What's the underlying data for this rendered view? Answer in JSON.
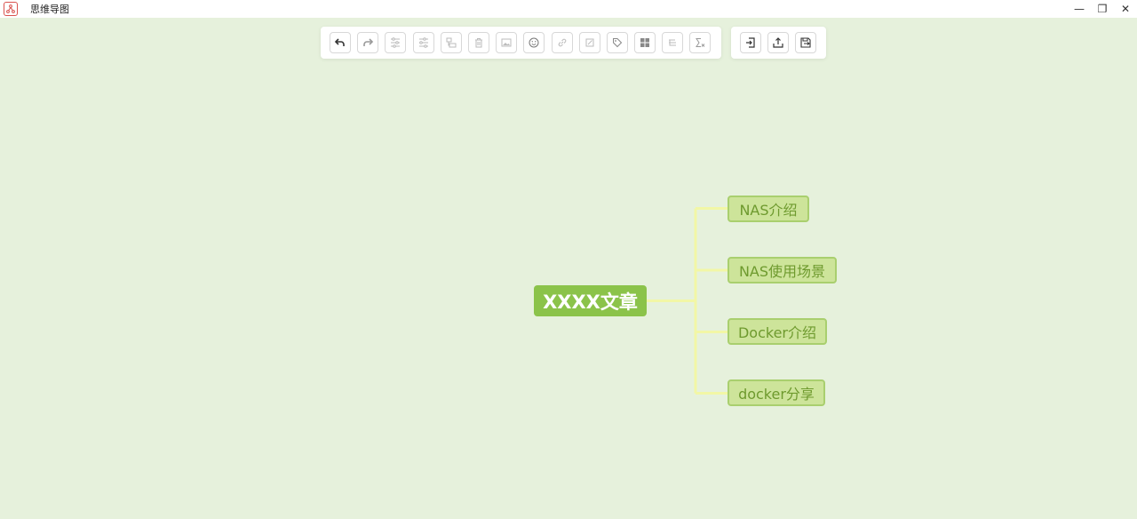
{
  "window": {
    "title": "思维导图",
    "controls": {
      "minimize": "—",
      "restore": "❐",
      "close": "✕"
    }
  },
  "toolbar": {
    "main_buttons": [
      {
        "name": "undo-icon",
        "enabled": true
      },
      {
        "name": "redo-icon",
        "enabled": true
      },
      {
        "name": "insert-child-icon",
        "enabled": false
      },
      {
        "name": "insert-sibling-icon",
        "enabled": false
      },
      {
        "name": "insert-parent-icon",
        "enabled": false
      },
      {
        "name": "delete-icon",
        "enabled": false
      },
      {
        "name": "image-icon",
        "enabled": false
      },
      {
        "name": "emoji-icon",
        "enabled": false
      },
      {
        "name": "link-icon",
        "enabled": false
      },
      {
        "name": "note-icon",
        "enabled": false
      },
      {
        "name": "tag-icon",
        "enabled": false
      },
      {
        "name": "summary-icon",
        "enabled": true
      },
      {
        "name": "association-icon",
        "enabled": false
      },
      {
        "name": "formula-icon",
        "enabled": false
      }
    ],
    "file_buttons": [
      {
        "name": "import-icon",
        "enabled": true
      },
      {
        "name": "export-icon",
        "enabled": true
      },
      {
        "name": "save-icon",
        "enabled": true
      }
    ]
  },
  "mindmap": {
    "root": {
      "label": "XXXX文章"
    },
    "children": [
      {
        "label": "NAS介绍"
      },
      {
        "label": "NAS使用场景"
      },
      {
        "label": "Docker介绍"
      },
      {
        "label": "docker分享"
      }
    ]
  },
  "colors": {
    "canvas": "#e6f1dc",
    "root_fill": "#8bc34a",
    "child_fill": "#cde49a",
    "child_border": "#a9cf6e",
    "child_text": "#6e9a2e",
    "connector": "#f2f7a6"
  }
}
